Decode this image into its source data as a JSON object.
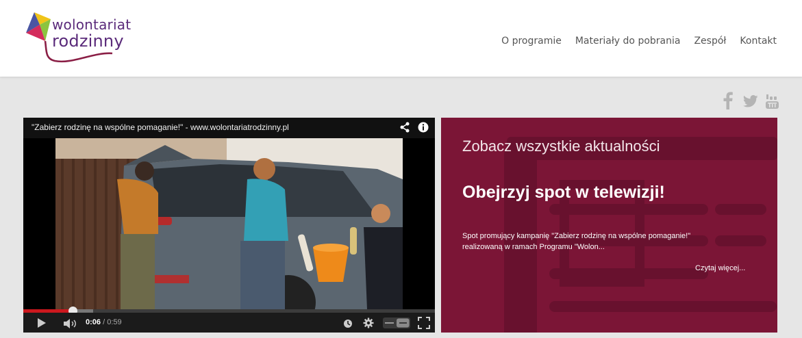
{
  "brand": {
    "logo_line1": "wolontariat",
    "logo_line2": "rodzinny",
    "logo_text_color": "#5a2a7a",
    "kite_colors": [
      "#d42c5c",
      "#f0c419",
      "#8cc43f",
      "#3a64b0",
      "#6a3a8c"
    ]
  },
  "nav": {
    "items": [
      {
        "label": "O programie"
      },
      {
        "label": "Materiały do pobrania"
      },
      {
        "label": "Zespół"
      },
      {
        "label": "Kontakt"
      }
    ]
  },
  "social": [
    "facebook-icon",
    "twitter-icon",
    "youtube-icon"
  ],
  "video": {
    "title": "\"Zabierz rodzinę na wspólne pomaganie!\" - www.wolontariatrodzinny.pl",
    "current_time": "0:06",
    "separator": " / ",
    "duration": "0:59",
    "progress": 0.12,
    "loaded": 0.17,
    "colors": {
      "played": "#cc181e",
      "track": "#3c3c3c"
    }
  },
  "news": {
    "heading": "Zobacz wszystkie aktualności",
    "title": "Obejrzyj spot w telewizji!",
    "excerpt_line1": "Spot promujący kampanię \"Zabierz rodzinę na wspólne pomaganie!\"",
    "excerpt_line2": "realizowaną w ramach Programu \"Wolon...",
    "read_more": "Czytaj więcej...",
    "background_color": "#7b1536"
  }
}
